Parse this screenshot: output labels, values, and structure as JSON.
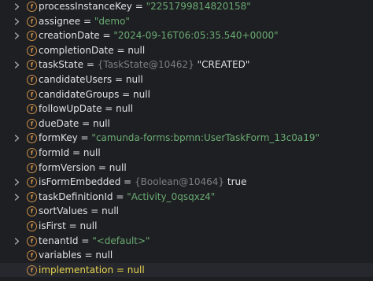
{
  "fields": [
    {
      "name": "processInstanceKey",
      "value": "\"2251799814820158\"",
      "value_kind": "string",
      "expandable": true,
      "selected": false
    },
    {
      "name": "assignee",
      "value": "\"demo\"",
      "value_kind": "string",
      "expandable": true,
      "selected": false
    },
    {
      "name": "creationDate",
      "value": "\"2024-09-16T06:05:35.540+0000\"",
      "value_kind": "string",
      "expandable": true,
      "selected": false
    },
    {
      "name": "completionDate",
      "value": "null",
      "value_kind": "plain",
      "expandable": false,
      "selected": false
    },
    {
      "name": "taskState",
      "ref": "{TaskState@10462}",
      "value": "\"CREATED\"",
      "value_kind": "plain",
      "expandable": true,
      "selected": false
    },
    {
      "name": "candidateUsers",
      "value": "null",
      "value_kind": "plain",
      "expandable": false,
      "selected": false
    },
    {
      "name": "candidateGroups",
      "value": "null",
      "value_kind": "plain",
      "expandable": false,
      "selected": false
    },
    {
      "name": "followUpDate",
      "value": "null",
      "value_kind": "plain",
      "expandable": false,
      "selected": false
    },
    {
      "name": "dueDate",
      "value": "null",
      "value_kind": "plain",
      "expandable": false,
      "selected": false
    },
    {
      "name": "formKey",
      "value": "\"camunda-forms:bpmn:UserTaskForm_13c0a19\"",
      "value_kind": "string",
      "expandable": true,
      "selected": false
    },
    {
      "name": "formId",
      "value": "null",
      "value_kind": "plain",
      "expandable": false,
      "selected": false
    },
    {
      "name": "formVersion",
      "value": "null",
      "value_kind": "plain",
      "expandable": false,
      "selected": false
    },
    {
      "name": "isFormEmbedded",
      "ref": "{Boolean@10464}",
      "value": "true",
      "value_kind": "plain",
      "expandable": true,
      "selected": false
    },
    {
      "name": "taskDefinitionId",
      "value": "\"Activity_0qsqxz4\"",
      "value_kind": "string",
      "expandable": true,
      "selected": false
    },
    {
      "name": "sortValues",
      "value": "null",
      "value_kind": "plain",
      "expandable": false,
      "selected": false
    },
    {
      "name": "isFirst",
      "value": "null",
      "value_kind": "plain",
      "expandable": false,
      "selected": false
    },
    {
      "name": "tenantId",
      "value": "\"<default>\"",
      "value_kind": "string",
      "expandable": true,
      "selected": false
    },
    {
      "name": "variables",
      "value": "null",
      "value_kind": "plain",
      "expandable": false,
      "selected": false
    },
    {
      "name": "implementation",
      "value": "null",
      "value_kind": "plain",
      "expandable": false,
      "selected": true
    }
  ],
  "field_icon_letter": "f",
  "equals_sign": " = ",
  "colors": {
    "background": "#1e1f22",
    "text": "#dfe1e5",
    "string_value": "#6aab73",
    "reference": "#7b7f86",
    "field_icon": "#c98e4a",
    "selected_text": "#e8d44d"
  },
  "icons": {
    "expand": "chevron-right-icon",
    "field": "field-icon"
  }
}
